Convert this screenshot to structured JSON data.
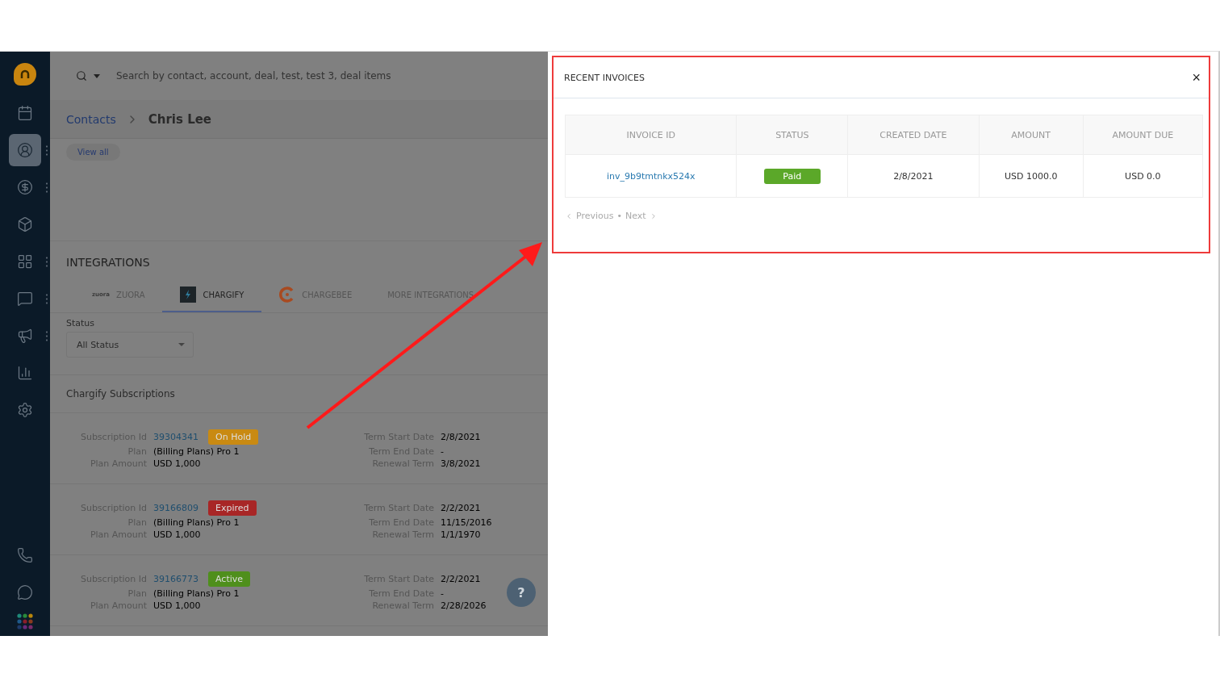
{
  "sidebar": {
    "items": [
      {
        "selected": false
      },
      {
        "selected": true,
        "menu": true
      },
      {
        "selected": false,
        "menu": true
      },
      {
        "selected": false
      },
      {
        "selected": false,
        "menu": true
      },
      {
        "selected": false,
        "menu": true
      },
      {
        "selected": false,
        "menu": true
      },
      {
        "selected": false
      },
      {
        "selected": false
      }
    ]
  },
  "search": {
    "placeholder": "Search by contact, account, deal, test, test 3, deal items"
  },
  "breadcrumb": {
    "parent": "Contacts",
    "current": "Chris Lee"
  },
  "view_all": "View all",
  "integrations": {
    "title": "INTEGRATIONS",
    "tabs": [
      {
        "label": "ZUORA",
        "logo_text": "zuora",
        "kind": "zuora",
        "selected": false
      },
      {
        "label": "CHARGIFY",
        "kind": "chargify",
        "selected": true
      },
      {
        "label": "CHARGEBEE",
        "kind": "chargebee",
        "selected": false
      },
      {
        "label": "MORE INTEGRATIONS",
        "kind": "plain",
        "selected": false
      }
    ],
    "status_label": "Status",
    "status_value": "All Status"
  },
  "subscriptions": {
    "title": "Chargify Subscriptions",
    "items": [
      {
        "id_label": "Subscription Id",
        "id": "39304341",
        "status": "On Hold",
        "color": "#c98a12",
        "plan_label": "Plan",
        "plan": "(Billing Plans) Pro 1",
        "amount_label": "Plan Amount",
        "amount": "USD 1,000",
        "start_label": "Term Start Date",
        "start": "2/8/2021",
        "end_label": "Term End Date",
        "end": "-",
        "renewal_label": "Renewal Term",
        "renewal": "3/8/2021"
      },
      {
        "id_label": "Subscription Id",
        "id": "39166809",
        "status": "Expired",
        "color": "#a82626",
        "plan_label": "Plan",
        "plan": "(Billing Plans) Pro 1",
        "amount_label": "Plan Amount",
        "amount": "USD 1,000",
        "start_label": "Term Start Date",
        "start": "2/2/2021",
        "end_label": "Term End Date",
        "end": "11/15/2016",
        "renewal_label": "Renewal Term",
        "renewal": "1/1/1970"
      },
      {
        "id_label": "Subscription Id",
        "id": "39166773",
        "status": "Active",
        "color": "#4f8f1c",
        "plan_label": "Plan",
        "plan": "(Billing Plans) Pro 1",
        "amount_label": "Plan Amount",
        "amount": "USD 1,000",
        "start_label": "Term Start Date",
        "start": "2/2/2021",
        "end_label": "Term End Date",
        "end": "-",
        "renewal_label": "Renewal Term",
        "renewal": "2/28/2026"
      }
    ]
  },
  "help": "?",
  "invoices": {
    "title": "RECENT INVOICES",
    "close": "×",
    "columns": [
      "INVOICE ID",
      "STATUS",
      "CREATED DATE",
      "AMOUNT",
      "AMOUNT DUE"
    ],
    "rows": [
      {
        "id": "inv_9b9tmtnkx524x",
        "status": "Paid",
        "created": "2/8/2021",
        "amount": "USD 1000.0",
        "due": "USD 0.0"
      }
    ],
    "previous": "Previous",
    "separator": "•",
    "next": "Next"
  }
}
